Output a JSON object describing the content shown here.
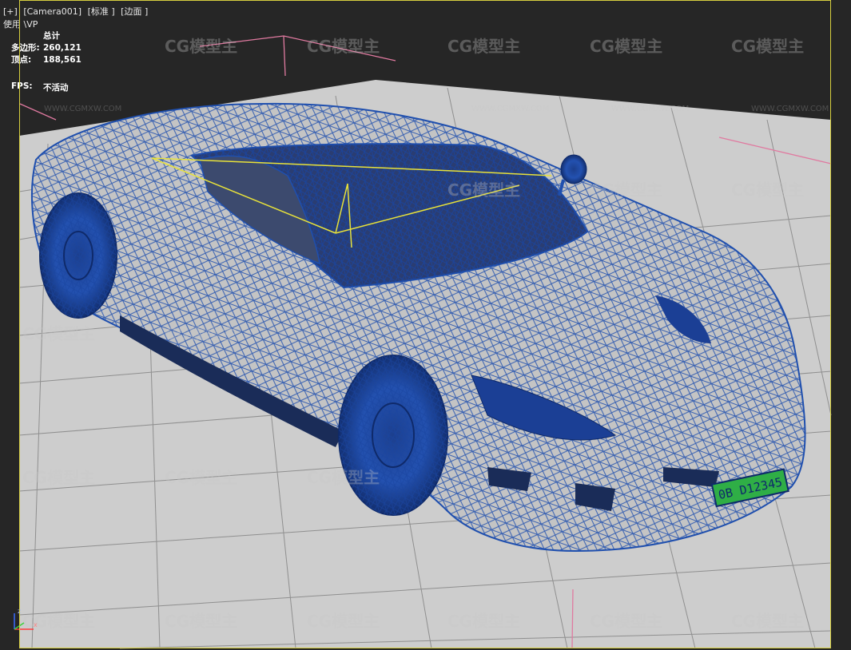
{
  "viewport": {
    "label_plus": "[+]",
    "label_camera": "[Camera001]",
    "label_shading": "[标准 ]",
    "label_mode": "[边面 ]",
    "label_vp": "使用 \\VP"
  },
  "stats": {
    "header": "总计",
    "polygons_label": "多边形:",
    "polygons_value": "260,121",
    "vertices_label": "顶点:",
    "vertices_value": "188,561",
    "fps_label": "FPS:",
    "fps_value": "不活动"
  },
  "watermark": {
    "brand": "CG模型主",
    "url": "WWW.CGMXW.COM"
  },
  "license_plate": "0B D12345",
  "gizmo": {
    "z": "z",
    "x": "x"
  },
  "colors": {
    "wire": "#1f4fae",
    "floor": "#cfcfcf",
    "grid": "#8f8f8f",
    "frame": "#d6cf3f",
    "plate": "#2fae46"
  }
}
